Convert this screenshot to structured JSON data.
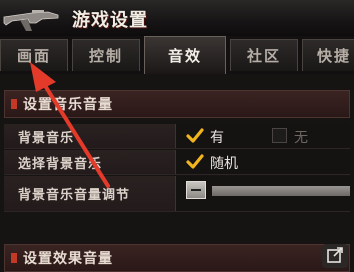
{
  "window": {
    "title": "游戏设置"
  },
  "tabs": [
    {
      "label": "画面",
      "active": false
    },
    {
      "label": "控制",
      "active": false
    },
    {
      "label": "音效",
      "active": true
    },
    {
      "label": "社区",
      "active": false
    },
    {
      "label": "快捷",
      "active": false
    }
  ],
  "music_section": {
    "title": "设置音乐音量",
    "rows": [
      {
        "label": "背景音乐",
        "option_on": "有",
        "option_off": "无"
      },
      {
        "label": "选择背景音乐",
        "option_on": "随机"
      },
      {
        "label": "背景音乐音量调节"
      }
    ]
  },
  "effects_section": {
    "title": "设置效果音量"
  },
  "colors": {
    "accent_red": "#e43a2a",
    "check_yellow": "#f2b51d"
  },
  "icons": [
    "gun-icon",
    "checkmark-icon",
    "minus-icon",
    "popout-icon",
    "pointer-arrow"
  ]
}
